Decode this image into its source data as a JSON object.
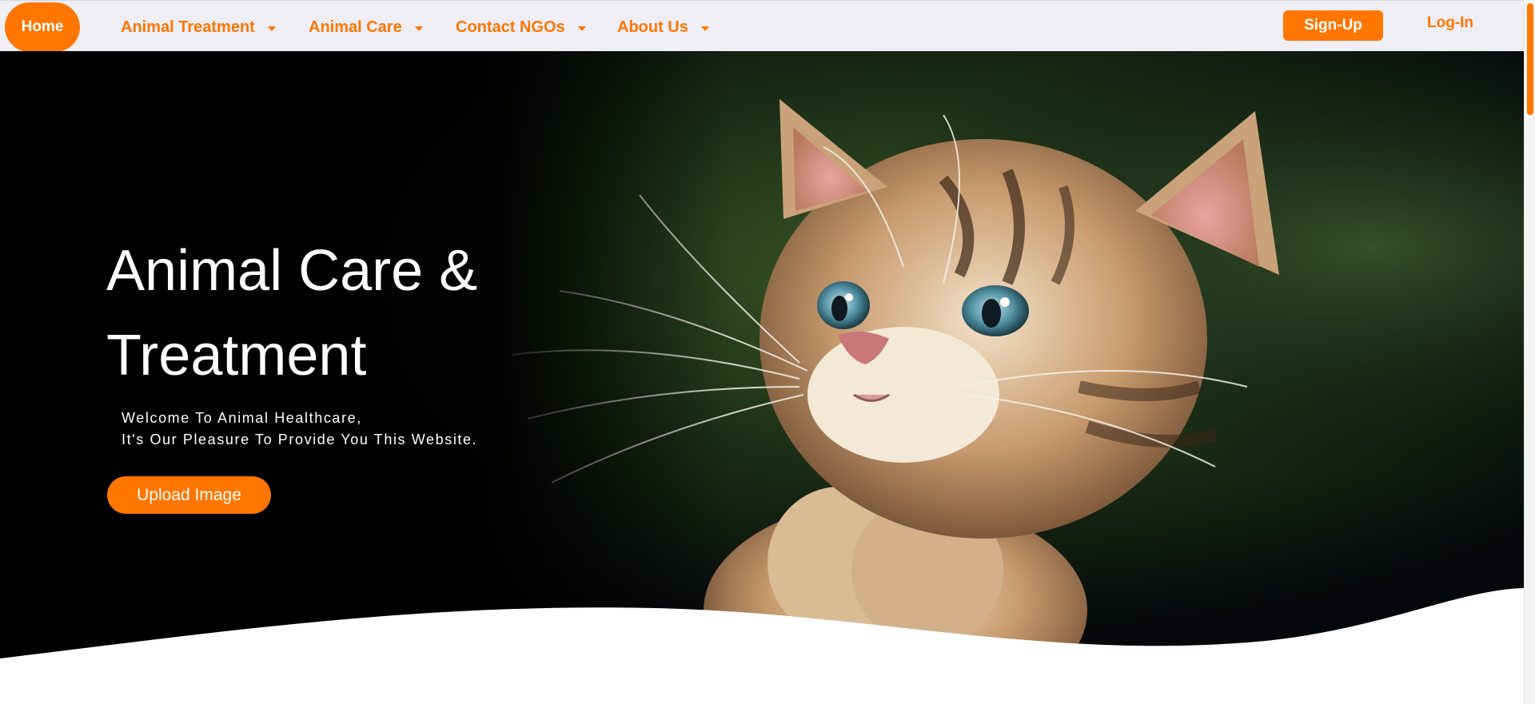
{
  "nav": {
    "home": "Home",
    "items": [
      {
        "label": "Animal Treatment"
      },
      {
        "label": "Animal Care"
      },
      {
        "label": "Contact NGOs"
      },
      {
        "label": "About Us"
      }
    ],
    "signup": "Sign-Up",
    "login": "Log-In"
  },
  "hero": {
    "title_line1": "Animal Care &",
    "title_line2": "Treatment",
    "subtitle_line1": "Welcome To Animal Healthcare,",
    "subtitle_line2": "It's Our Pleasure To Provide You This Website.",
    "upload_label": "Upload Image",
    "photo": "kitten-looking-up-photo"
  },
  "colors": {
    "accent": "#ff7600",
    "navbar_bg": "#efeef5",
    "hero_bg": "#05070a",
    "text_light": "#ffffff"
  },
  "icons": {
    "dropdown": "caret-down-icon"
  }
}
